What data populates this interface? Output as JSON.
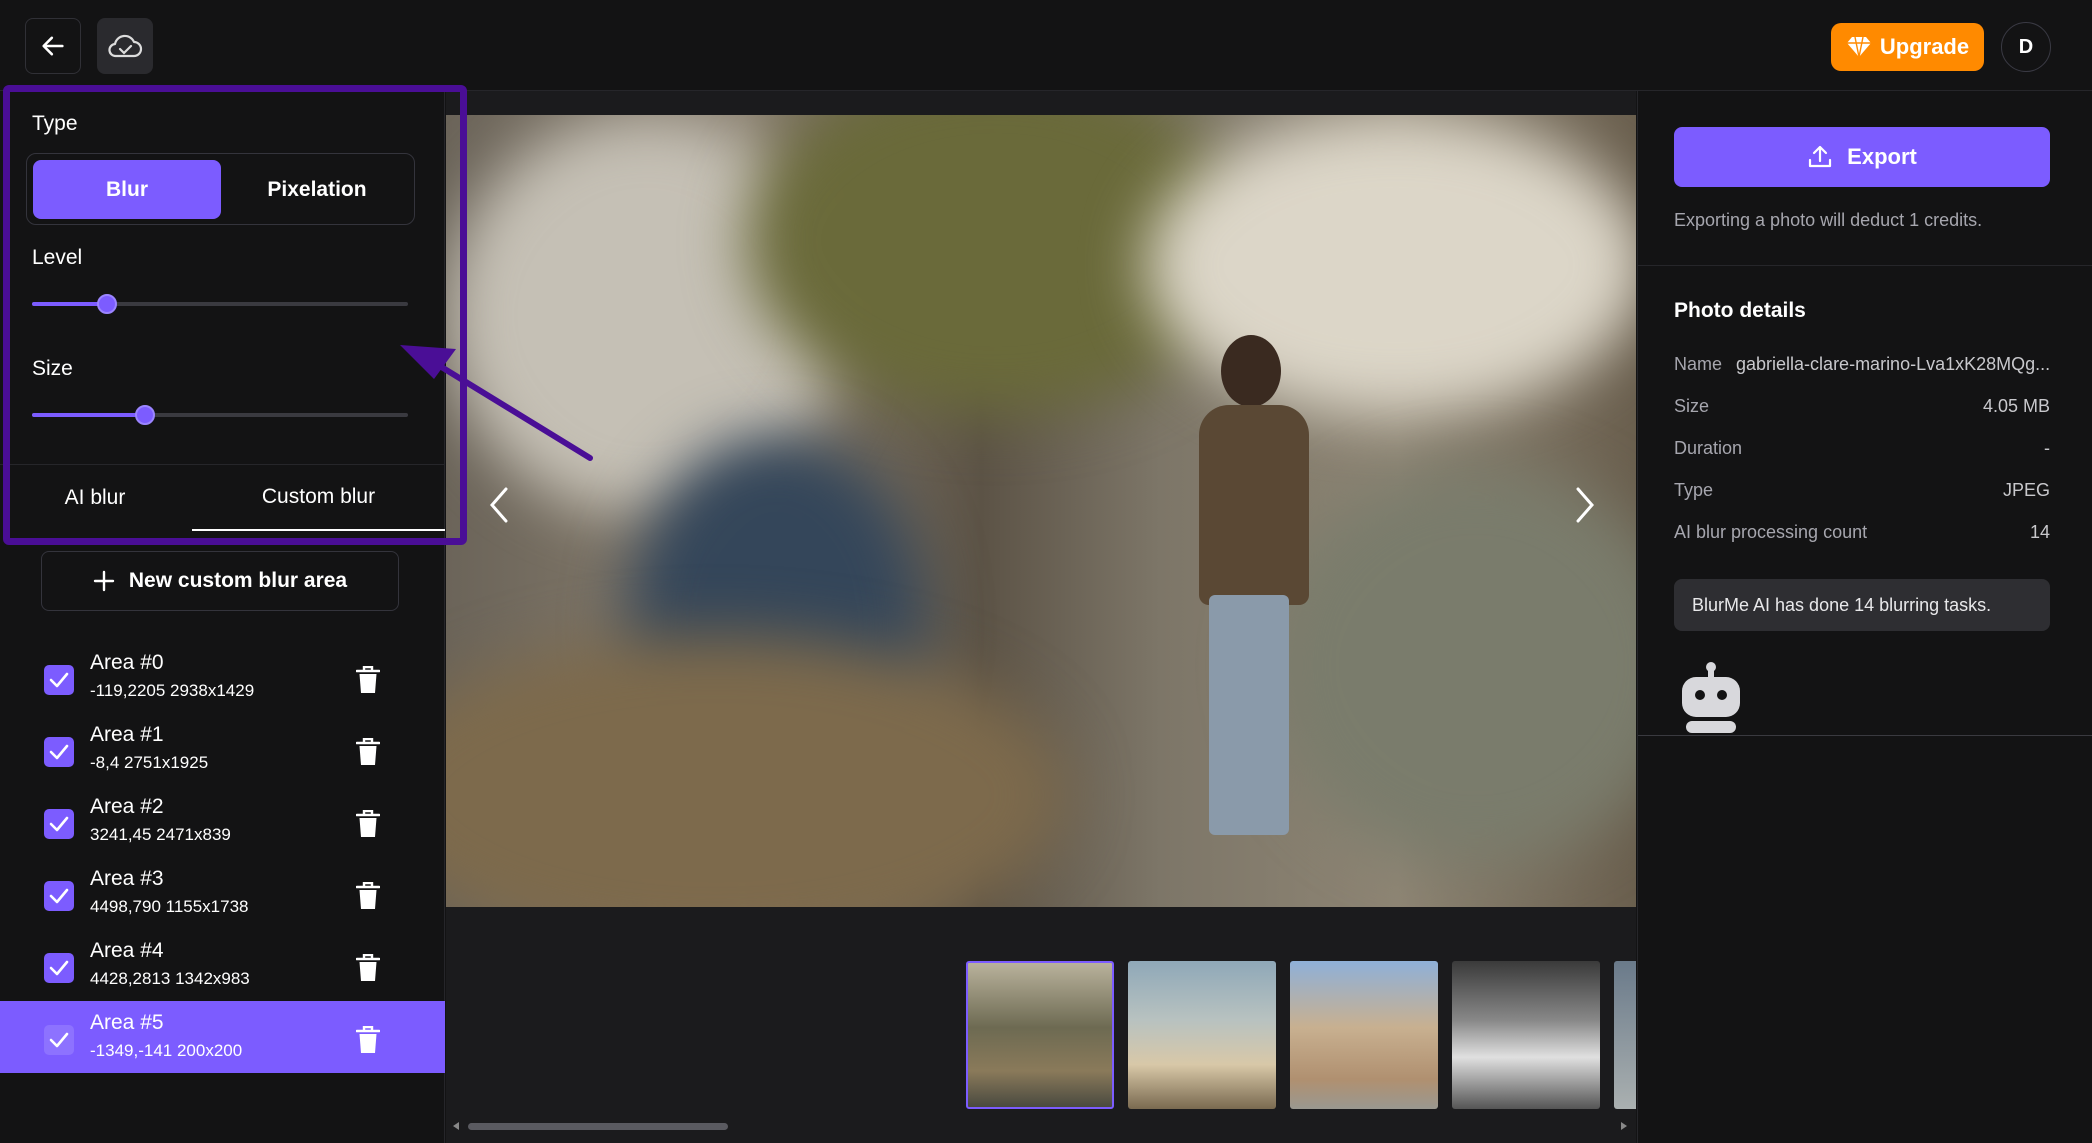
{
  "topbar": {
    "back_icon": "arrow-left-icon",
    "cloud_icon": "cloud-check-icon",
    "upgrade_label": "Upgrade",
    "avatar_initial": "D"
  },
  "left": {
    "type_label": "Type",
    "type_options": [
      "Blur",
      "Pixelation"
    ],
    "type_selected": "Blur",
    "level_label": "Level",
    "level_value_fraction": 0.2,
    "size_label": "Size",
    "size_value_fraction": 0.3,
    "tabs": [
      "AI blur",
      "Custom blur"
    ],
    "active_tab": "Custom blur",
    "new_area_label": "New custom blur area",
    "areas": [
      {
        "name": "Area #0",
        "coords": "-119,2205 2938x1429",
        "checked": true
      },
      {
        "name": "Area #1",
        "coords": "-8,4 2751x1925",
        "checked": true
      },
      {
        "name": "Area #2",
        "coords": "3241,45 2471x839",
        "checked": true
      },
      {
        "name": "Area #3",
        "coords": "4498,790 1155x1738",
        "checked": true
      },
      {
        "name": "Area #4",
        "coords": "4428,2813 1342x983",
        "checked": true
      },
      {
        "name": "Area #5",
        "coords": "-1349,-141 200x200",
        "checked": true,
        "selected": true
      }
    ]
  },
  "right": {
    "export_label": "Export",
    "export_note": "Exporting a photo will deduct 1 credits.",
    "details_title": "Photo details",
    "details": {
      "name_label": "Name",
      "name_value": "gabriella-clare-marino-Lva1xK28MQg...",
      "size_label": "Size",
      "size_value": "4.05 MB",
      "duration_label": "Duration",
      "duration_value": "-",
      "type_label": "Type",
      "type_value": "JPEG",
      "count_label": "AI blur processing count",
      "count_value": "14"
    },
    "bot_message": "BlurMe AI has done 14 blurring tasks.",
    "bot_icon": "robot-icon"
  },
  "colors": {
    "accent": "#7c5cff",
    "upgrade": "#ff8a00",
    "annotation": "#4a0e96"
  }
}
